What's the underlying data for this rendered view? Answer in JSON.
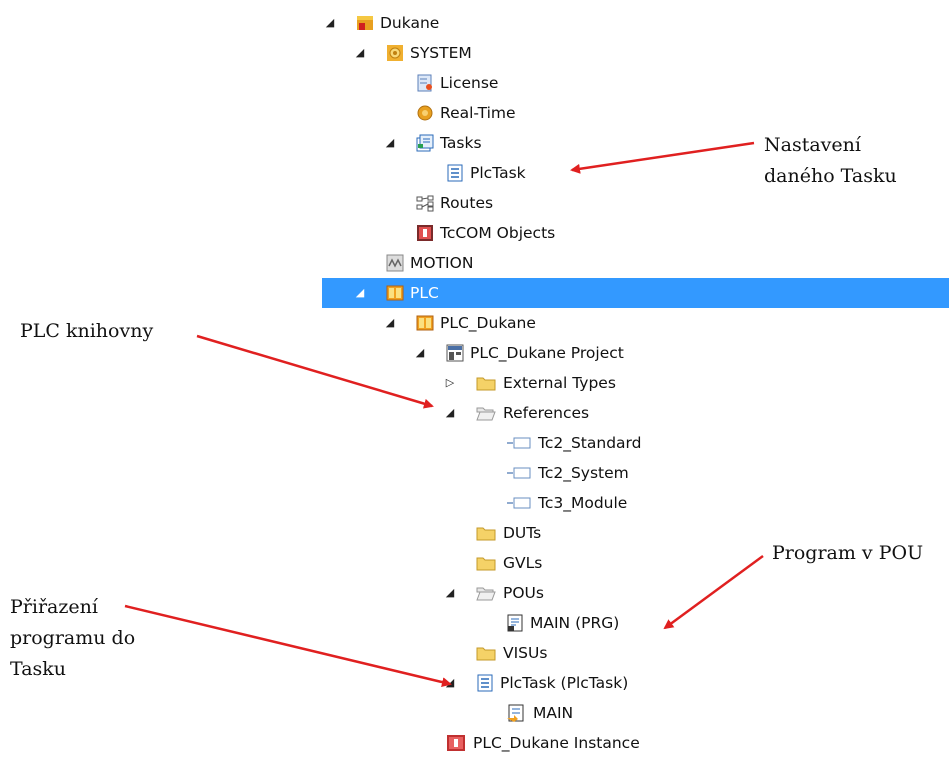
{
  "tree": {
    "items": [
      {
        "label": "Dukane",
        "icon": "solution-icon",
        "toggle": "expanded"
      },
      {
        "label": "SYSTEM",
        "icon": "system-gear-icon",
        "toggle": "expanded"
      },
      {
        "label": "License",
        "icon": "license-icon",
        "toggle": ""
      },
      {
        "label": "Real-Time",
        "icon": "realtime-icon",
        "toggle": ""
      },
      {
        "label": "Tasks",
        "icon": "tasks-icon",
        "toggle": "expanded"
      },
      {
        "label": "PlcTask",
        "icon": "task-icon",
        "toggle": ""
      },
      {
        "label": "Routes",
        "icon": "routes-icon",
        "toggle": ""
      },
      {
        "label": "TcCOM Objects",
        "icon": "tccom-icon",
        "toggle": ""
      },
      {
        "label": "MOTION",
        "icon": "motion-icon",
        "toggle": ""
      },
      {
        "label": "PLC",
        "icon": "plc-icon",
        "toggle": "expanded",
        "selected": true
      },
      {
        "label": "PLC_Dukane",
        "icon": "plc-icon",
        "toggle": "expanded"
      },
      {
        "label": "PLC_Dukane Project",
        "icon": "plc-project-icon",
        "toggle": "expanded"
      },
      {
        "label": "External Types",
        "icon": "folder-icon",
        "toggle": "collapsed"
      },
      {
        "label": "References",
        "icon": "open-folder-icon",
        "toggle": "expanded"
      },
      {
        "label": "Tc2_Standard",
        "icon": "reference-icon",
        "toggle": ""
      },
      {
        "label": "Tc2_System",
        "icon": "reference-icon",
        "toggle": ""
      },
      {
        "label": "Tc3_Module",
        "icon": "reference-icon",
        "toggle": ""
      },
      {
        "label": "DUTs",
        "icon": "folder-icon",
        "toggle": ""
      },
      {
        "label": "GVLs",
        "icon": "folder-icon",
        "toggle": ""
      },
      {
        "label": "POUs",
        "icon": "open-folder-icon",
        "toggle": "expanded"
      },
      {
        "label": "MAIN (PRG)",
        "icon": "program-icon",
        "toggle": ""
      },
      {
        "label": "VISUs",
        "icon": "folder-icon",
        "toggle": ""
      },
      {
        "label": "PlcTask (PlcTask)",
        "icon": "task-icon",
        "toggle": "expanded"
      },
      {
        "label": "MAIN",
        "icon": "program-call-icon",
        "toggle": ""
      },
      {
        "label": "PLC_Dukane Instance",
        "icon": "instance-icon",
        "toggle": ""
      }
    ]
  },
  "annotations": {
    "task_settings_line1": "Nastavení",
    "task_settings_line2": "daného Tasku",
    "plc_libraries": "PLC knihovny",
    "program_in_pou": "Program v POU",
    "assign_line1": "Přiřazení",
    "assign_line2": "programu do",
    "assign_line3": "Tasku"
  },
  "colors": {
    "selection": "#3399ff",
    "arrow": "#e02020",
    "folder": "#f0c040"
  }
}
